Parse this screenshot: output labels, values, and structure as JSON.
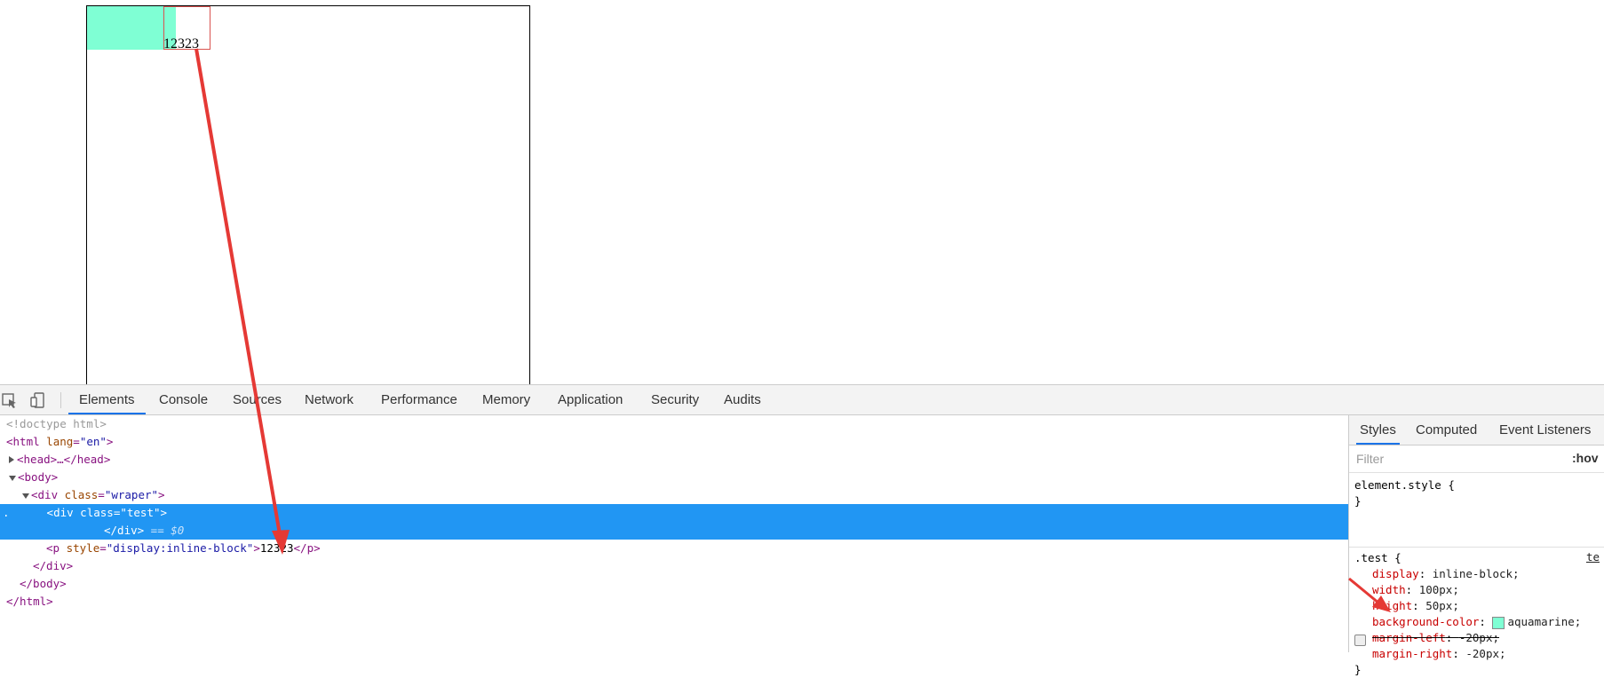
{
  "page": {
    "p_text": "12323"
  },
  "toolbar": {
    "inspect_icon": "inspect-element-icon",
    "device_icon": "device-toolbar-icon",
    "tabs": [
      "Elements",
      "Console",
      "Sources",
      "Network",
      "Performance",
      "Memory",
      "Application",
      "Security",
      "Audits"
    ]
  },
  "dom": {
    "doctype": "<!doctype html>",
    "html_open_tag": "html",
    "html_lang_attr": "lang",
    "html_lang_val": "\"en\"",
    "head_collapsed": "<head>…</head>",
    "body_open": "<body>",
    "div_wraper_tag": "div",
    "class_attr": "class",
    "wraper_val": "\"wraper\"",
    "div_test_val": "\"test\"",
    "div_close": "</div>",
    "eq_dollar": " == $0",
    "p_tag": "p",
    "style_attr": "style",
    "p_style_val": "\"display:inline-block\"",
    "p_text": "12323",
    "p_close": "</p>",
    "div_close2": "</div>",
    "body_close": "</body>",
    "html_close": "</html>"
  },
  "styles_panel": {
    "tabs": [
      "Styles",
      "Computed",
      "Event Listeners"
    ],
    "filter_placeholder": "Filter",
    "hov": ":hov",
    "element_style": "element.style {",
    "close_brace": "}",
    "rule_selector": ".test {",
    "source_link": "te",
    "declarations": [
      {
        "prop": "display",
        "value": "inline-block;"
      },
      {
        "prop": "width",
        "value": "100px;"
      },
      {
        "prop": "height",
        "value": "50px;"
      },
      {
        "prop": "background-color",
        "value": "aquamarine;"
      },
      {
        "prop": "margin-left",
        "value": "-20px;"
      },
      {
        "prop": "margin-right",
        "value": "-20px;"
      }
    ]
  },
  "colors": {
    "selection": "#2196f3",
    "swatch": "#7fffd4",
    "arrow": "#e53935"
  }
}
